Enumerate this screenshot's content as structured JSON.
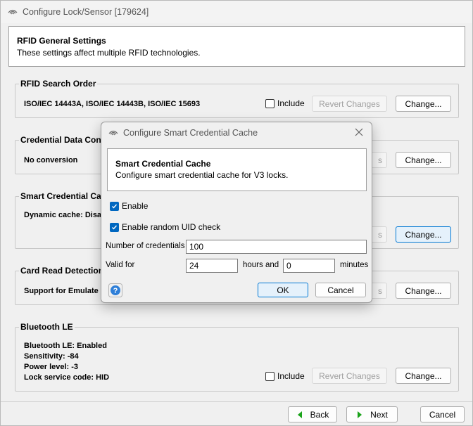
{
  "window": {
    "title": "Configure Lock/Sensor [179624]"
  },
  "header": {
    "title": "RFID General Settings",
    "subtitle": "These settings affect multiple RFID technologies."
  },
  "groups": {
    "rfid_search": {
      "title": "RFID Search Order",
      "value": "ISO/IEC 14443A, ISO/IEC 14443B, ISO/IEC 15693",
      "include_label": "Include",
      "revert_label": "Revert Changes",
      "change_label": "Change..."
    },
    "credential_data": {
      "title": "Credential Data Conv",
      "value": "No conversion",
      "revert_partial": "s",
      "change_label": "Change..."
    },
    "smart_cache": {
      "title": "Smart Credential Cac",
      "value": "Dynamic cache: Disa",
      "revert_partial": "s",
      "change_label": "Change..."
    },
    "card_read": {
      "title": "Card Read Detection",
      "value": "Support for Emulate",
      "revert_partial": "s",
      "change_label": "Change..."
    },
    "bluetooth": {
      "title": "Bluetooth LE",
      "lines": [
        "Bluetooth LE: Enabled",
        "Sensitivity: -84",
        "Power level: -3",
        "Lock service code: HID"
      ],
      "include_label": "Include",
      "revert_label": "Revert Changes",
      "change_label": "Change..."
    }
  },
  "footer": {
    "back_label": "Back",
    "next_label": "Next",
    "cancel_label": "Cancel"
  },
  "dialog": {
    "title": "Configure Smart Credential Cache",
    "header_title": "Smart Credential Cache",
    "header_sub": "Configure smart credential cache for V3 locks.",
    "enable_label": "Enable",
    "enable_checked": true,
    "random_uid_label": "Enable random UID check",
    "random_uid_checked": true,
    "num_credentials_label": "Number of credentials",
    "num_credentials_value": "100",
    "valid_for_label": "Valid for",
    "hours_value": "24",
    "hours_label": "hours and",
    "minutes_value": "0",
    "minutes_label": "minutes",
    "ok_label": "OK",
    "cancel_label": "Cancel"
  },
  "colors": {
    "accent": "#0067c0",
    "focus": "#0078d4",
    "green_arrow": "#1aa31a"
  }
}
